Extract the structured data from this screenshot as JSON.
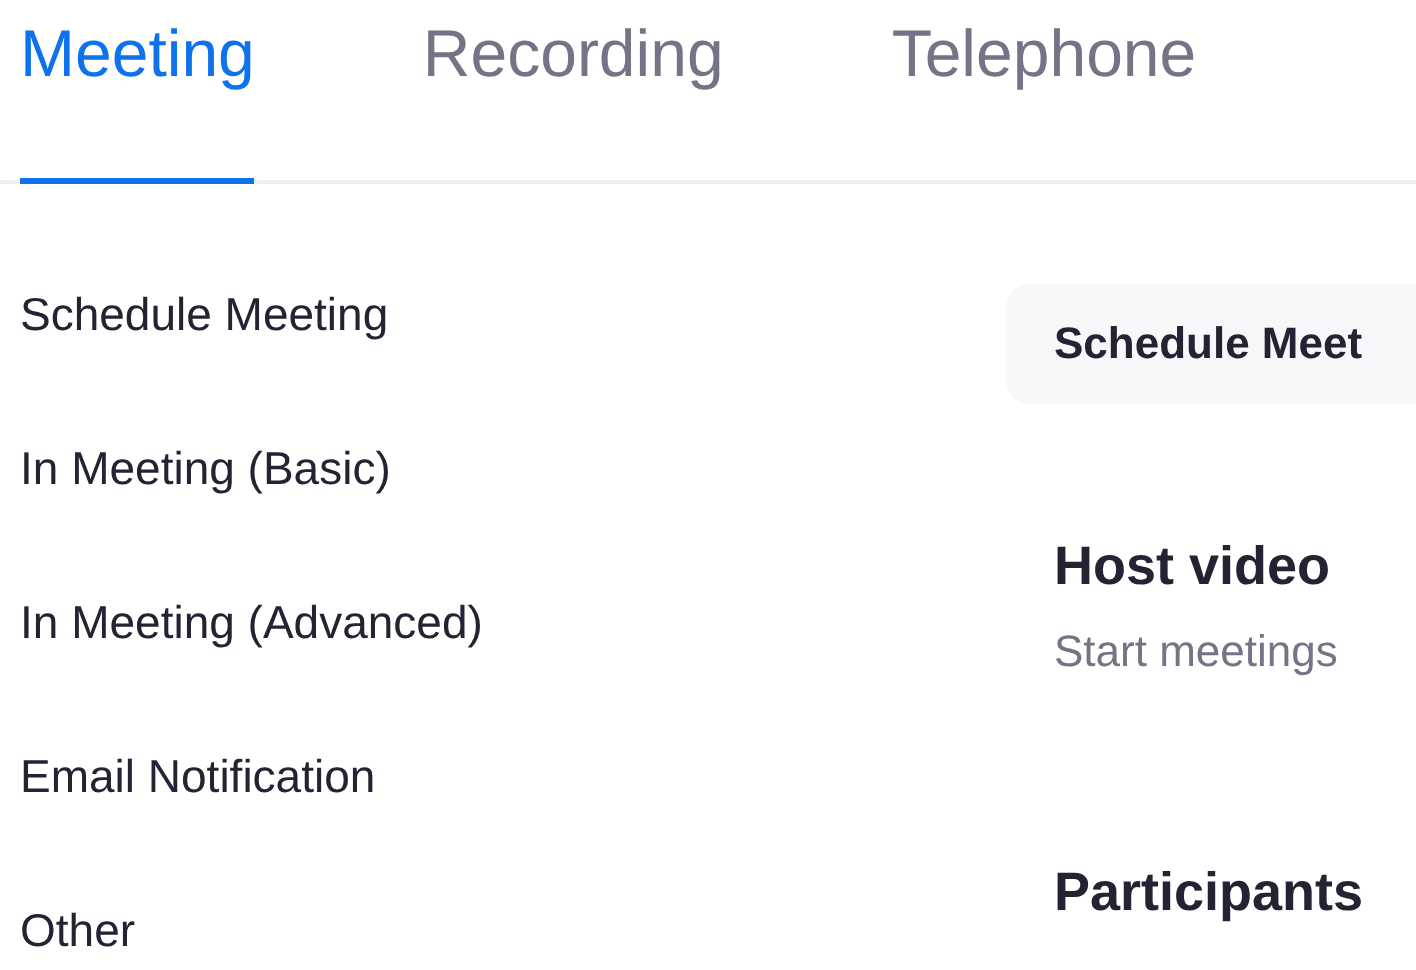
{
  "tabs": [
    {
      "label": "Meeting",
      "selected": true
    },
    {
      "label": "Recording",
      "selected": false
    },
    {
      "label": "Telephone",
      "selected": false
    }
  ],
  "sidebar": {
    "items": [
      {
        "label": "Schedule Meeting"
      },
      {
        "label": "In Meeting (Basic)"
      },
      {
        "label": "In Meeting (Advanced)"
      },
      {
        "label": "Email Notification"
      },
      {
        "label": "Other"
      }
    ]
  },
  "content": {
    "section_tab": "Schedule Meet",
    "settings": [
      {
        "title": "Host video",
        "description": "Start meetings"
      },
      {
        "title": "Participants"
      }
    ]
  }
}
